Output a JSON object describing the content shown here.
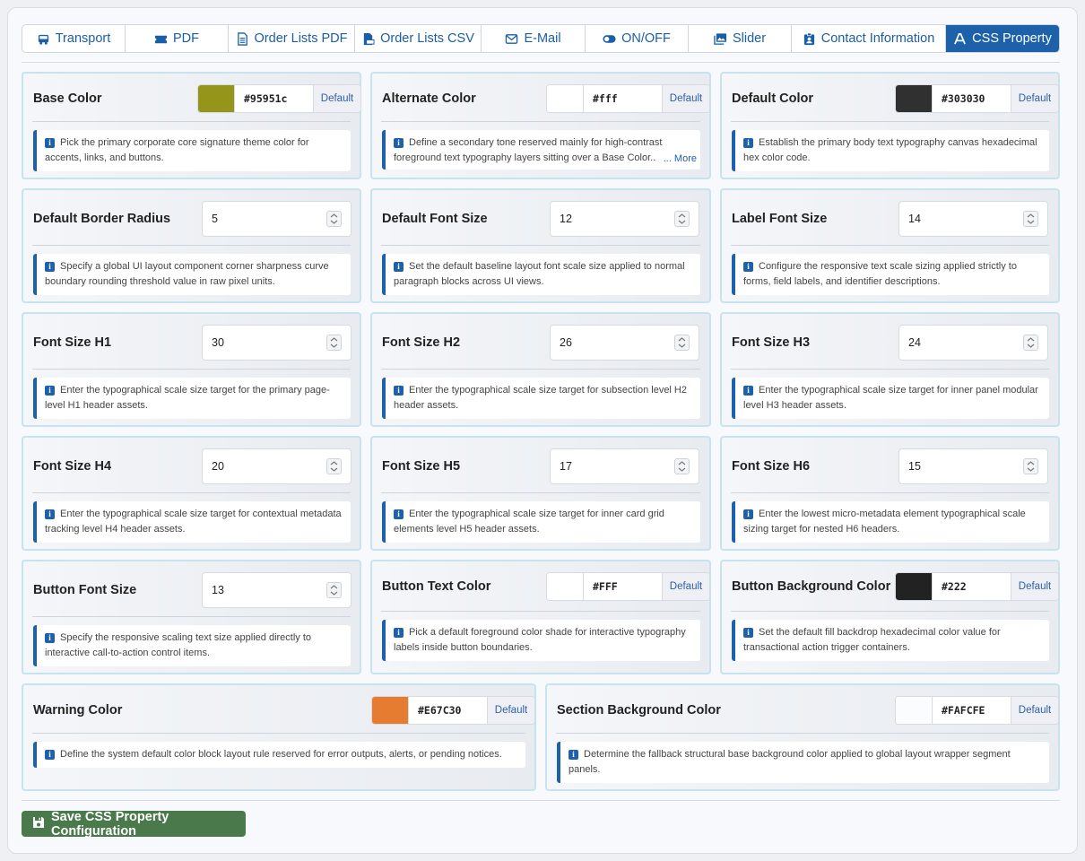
{
  "tabs": [
    {
      "label": "Transport",
      "icon": "bus-icon"
    },
    {
      "label": "PDF",
      "icon": "ticket-icon"
    },
    {
      "label": "Order Lists PDF",
      "icon": "file-text-icon"
    },
    {
      "label": "Order Lists CSV",
      "icon": "file-csv-icon"
    },
    {
      "label": "E-Mail",
      "icon": "envelope-icon"
    },
    {
      "label": "ON/OFF",
      "icon": "toggle-icon"
    },
    {
      "label": "Slider",
      "icon": "images-icon"
    },
    {
      "label": "Contact Information",
      "icon": "id-badge-icon"
    },
    {
      "label": "CSS Property",
      "icon": "font-icon",
      "active": true
    }
  ],
  "default_label": "Default",
  "more_label": "... More",
  "info_glyph": "i",
  "cards": {
    "base_color": {
      "title": "Base Color",
      "value": "#95951c",
      "swatch": "#95951c",
      "info": "Pick the primary corporate core signature theme color for accents, links, and buttons."
    },
    "alternate_color": {
      "title": "Alternate Color",
      "value": "#fff",
      "swatch": "#ffffff",
      "info": "Define a secondary tone reserved mainly for high-contrast foreground text typography layers sitting over a Base Color.."
    },
    "default_color": {
      "title": "Default Color",
      "value": "#303030",
      "swatch": "#303030",
      "info": "Establish the primary body text typography canvas hexadecimal hex color code."
    },
    "border_radius": {
      "title": "Default Border Radius",
      "value": "5",
      "info": "Specify a global UI layout component corner sharpness curve boundary rounding threshold value in raw pixel units."
    },
    "font_size": {
      "title": "Default Font Size",
      "value": "12",
      "info": "Set the default baseline layout font scale size applied to normal paragraph blocks across UI views."
    },
    "label_font_size": {
      "title": "Label Font Size",
      "value": "14",
      "info": "Configure the responsive text scale sizing applied strictly to forms, field labels, and identifier descriptions."
    },
    "h1": {
      "title": "Font Size H1",
      "value": "30",
      "info": "Enter the typographical scale size target for the primary page-level H1 header assets."
    },
    "h2": {
      "title": "Font Size H2",
      "value": "26",
      "info": "Enter the typographical scale size target for subsection level H2 header assets."
    },
    "h3": {
      "title": "Font Size H3",
      "value": "24",
      "info": "Enter the typographical scale size target for inner panel modular level H3 header assets."
    },
    "h4": {
      "title": "Font Size H4",
      "value": "20",
      "info": "Enter the typographical scale size target for contextual metadata tracking level H4 header assets."
    },
    "h5": {
      "title": "Font Size H5",
      "value": "17",
      "info": "Enter the typographical scale size target for inner card grid elements level H5 header assets."
    },
    "h6": {
      "title": "Font Size H6",
      "value": "15",
      "info": "Enter the lowest micro-metadata element typographical scale sizing target for nested H6 headers."
    },
    "button_font_size": {
      "title": "Button Font Size",
      "value": "13",
      "info": "Specify the responsive scaling text size applied directly to interactive call-to-action control items."
    },
    "button_text_color": {
      "title": "Button Text Color",
      "value": "#FFF",
      "swatch": "#ffffff",
      "info": "Pick a default foreground color shade for interactive typography labels inside button boundaries."
    },
    "button_bg_color": {
      "title": "Button Background Color",
      "value": "#222",
      "swatch": "#222222",
      "info": "Set the default fill backdrop hexadecimal color value for transactional action trigger containers."
    },
    "warning_color": {
      "title": "Warning Color",
      "value": "#E67C30",
      "swatch": "#e67c30",
      "info": "Define the system default color block layout rule reserved for error outputs, alerts, or pending notices."
    },
    "section_bg_color": {
      "title": "Section Background Color",
      "value": "#FAFCFE",
      "swatch": "#fafcfe",
      "info": "Determine the fallback structural base background color applied to global layout wrapper segment panels."
    }
  },
  "save_button": {
    "label": "Save CSS Property Configuration",
    "color": "#4a7a4b"
  }
}
